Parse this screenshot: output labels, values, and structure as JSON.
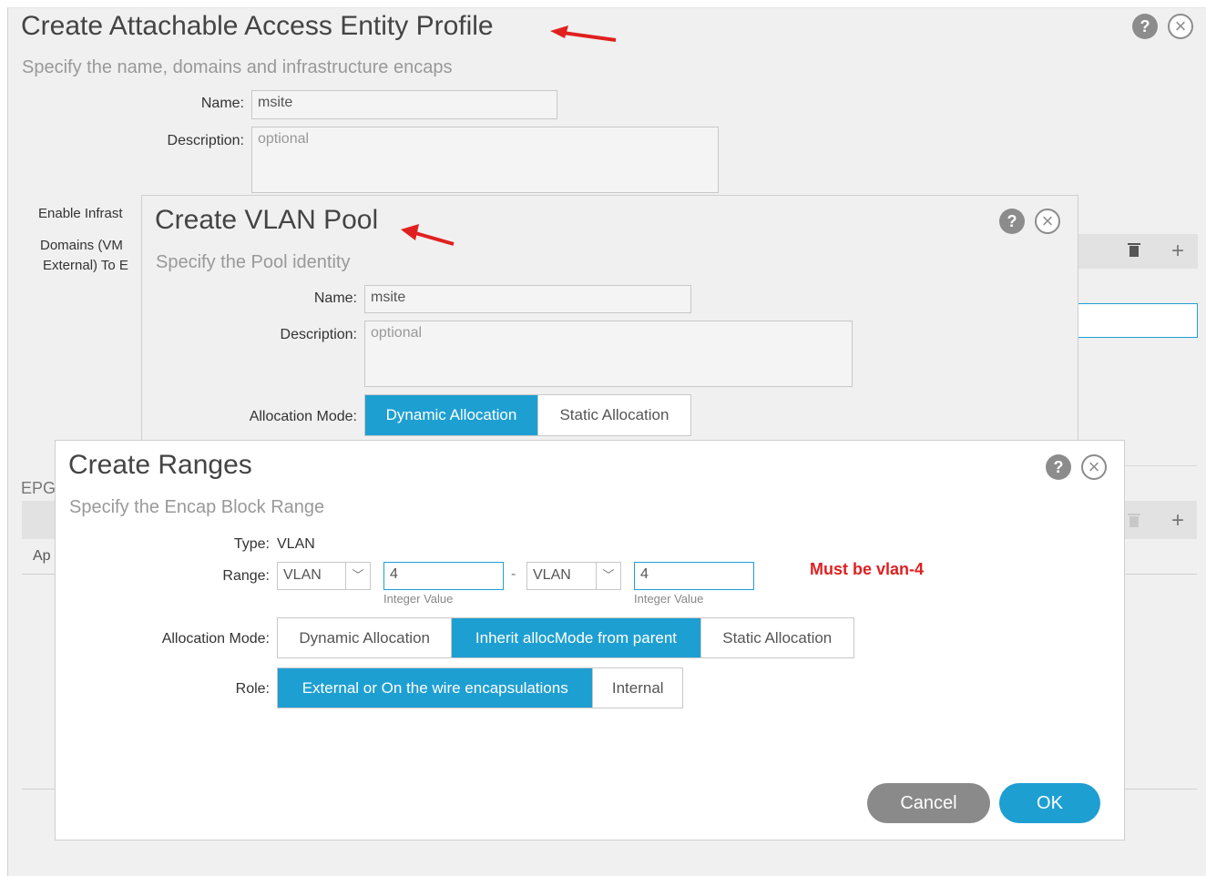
{
  "aaep": {
    "title": "Create Attachable Access Entity Profile",
    "subtitle": "Specify the name, domains and infrastructure encaps",
    "name_label": "Name:",
    "name_value": "msite",
    "description_label": "Description:",
    "description_placeholder": "optional",
    "enable_infra_label": "Enable Infrast",
    "domains_label_line1": "Domains (VM",
    "domains_label_line2": "External) To E",
    "epg_label": "EPG",
    "ap_label": "Ap",
    "help_icon": "?",
    "close_icon": "×",
    "trash_icon": "▾",
    "add_icon": "+"
  },
  "vlan_pool": {
    "title": "Create VLAN Pool",
    "subtitle": "Specify the Pool identity",
    "name_label": "Name:",
    "name_value": "msite",
    "description_label": "Description:",
    "description_placeholder": "optional",
    "alloc_label": "Allocation Mode:",
    "alloc_options": [
      "Dynamic Allocation",
      "Static Allocation"
    ],
    "alloc_selected": "Dynamic Allocation"
  },
  "ranges": {
    "title": "Create Ranges",
    "subtitle": "Specify the Encap Block Range",
    "type_label": "Type:",
    "type_value": "VLAN",
    "range_label": "Range:",
    "from_type": "VLAN",
    "from_value": "4",
    "from_hint": "Integer Value",
    "separator": "-",
    "to_type": "VLAN",
    "to_value": "4",
    "to_hint": "Integer Value",
    "annotation": "Must be vlan-4",
    "alloc_label": "Allocation Mode:",
    "alloc_options": [
      "Dynamic Allocation",
      "Inherit allocMode from parent",
      "Static Allocation"
    ],
    "alloc_selected": "Inherit allocMode from parent",
    "role_label": "Role:",
    "role_options": [
      "External or On the wire encapsulations",
      "Internal"
    ],
    "role_selected": "External or On the wire encapsulations",
    "cancel_label": "Cancel",
    "ok_label": "OK"
  },
  "colors": {
    "accent": "#1e9fd2",
    "annotation": "#e02020",
    "arrow": "#e02020",
    "cancel": "#8a8a8a"
  }
}
